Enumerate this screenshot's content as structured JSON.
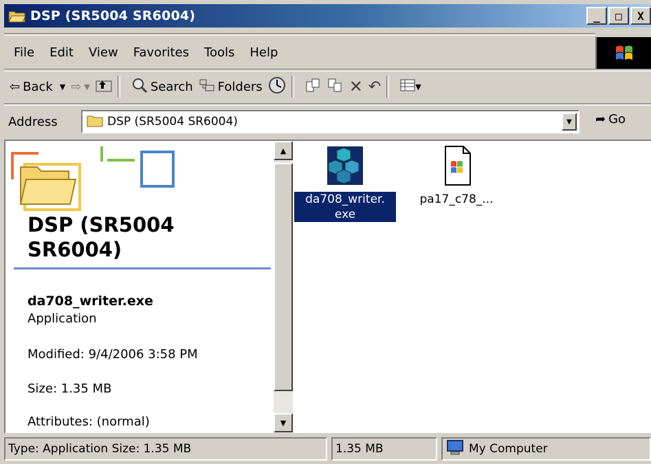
{
  "window": {
    "title": "DSP (SR5004 SR6004)",
    "buttons": {
      "minimize": "_",
      "maximize": "□",
      "close": "X"
    }
  },
  "menu": [
    {
      "label": "File"
    },
    {
      "label": "Edit"
    },
    {
      "label": "View"
    },
    {
      "label": "Favorites"
    },
    {
      "label": "Tools"
    },
    {
      "label": "Help"
    }
  ],
  "toolbar": {
    "back": "Back",
    "search": "Search",
    "folders": "Folders"
  },
  "address": {
    "label": "Address",
    "value": "DSP (SR5004 SR6004)",
    "go": "Go"
  },
  "details_pane": {
    "folder_title": "DSP (SR5004 SR6004)",
    "selected_name": "da708_writer.exe",
    "selected_type": "Application",
    "modified": "Modified: 9/4/2006 3:58 PM",
    "size": "Size: 1.35 MB",
    "attributes": "Attributes: (normal)"
  },
  "files": [
    {
      "label_line1": "da708_writer.",
      "label_line2": "exe",
      "icon": "mfc-exe-icon",
      "selected": true
    },
    {
      "label_line1": "pa17_c78_...",
      "label_line2": "",
      "icon": "setup-document-icon",
      "selected": false
    }
  ],
  "status": {
    "info": "Type: Application Size: 1.35 MB",
    "size": "1.35 MB",
    "zone": "My Computer"
  },
  "colors": {
    "titlebar_start": "#0a246a",
    "titlebar_end": "#a6caf0",
    "selection": "#0a246a",
    "chrome": "#d4d0c8"
  }
}
